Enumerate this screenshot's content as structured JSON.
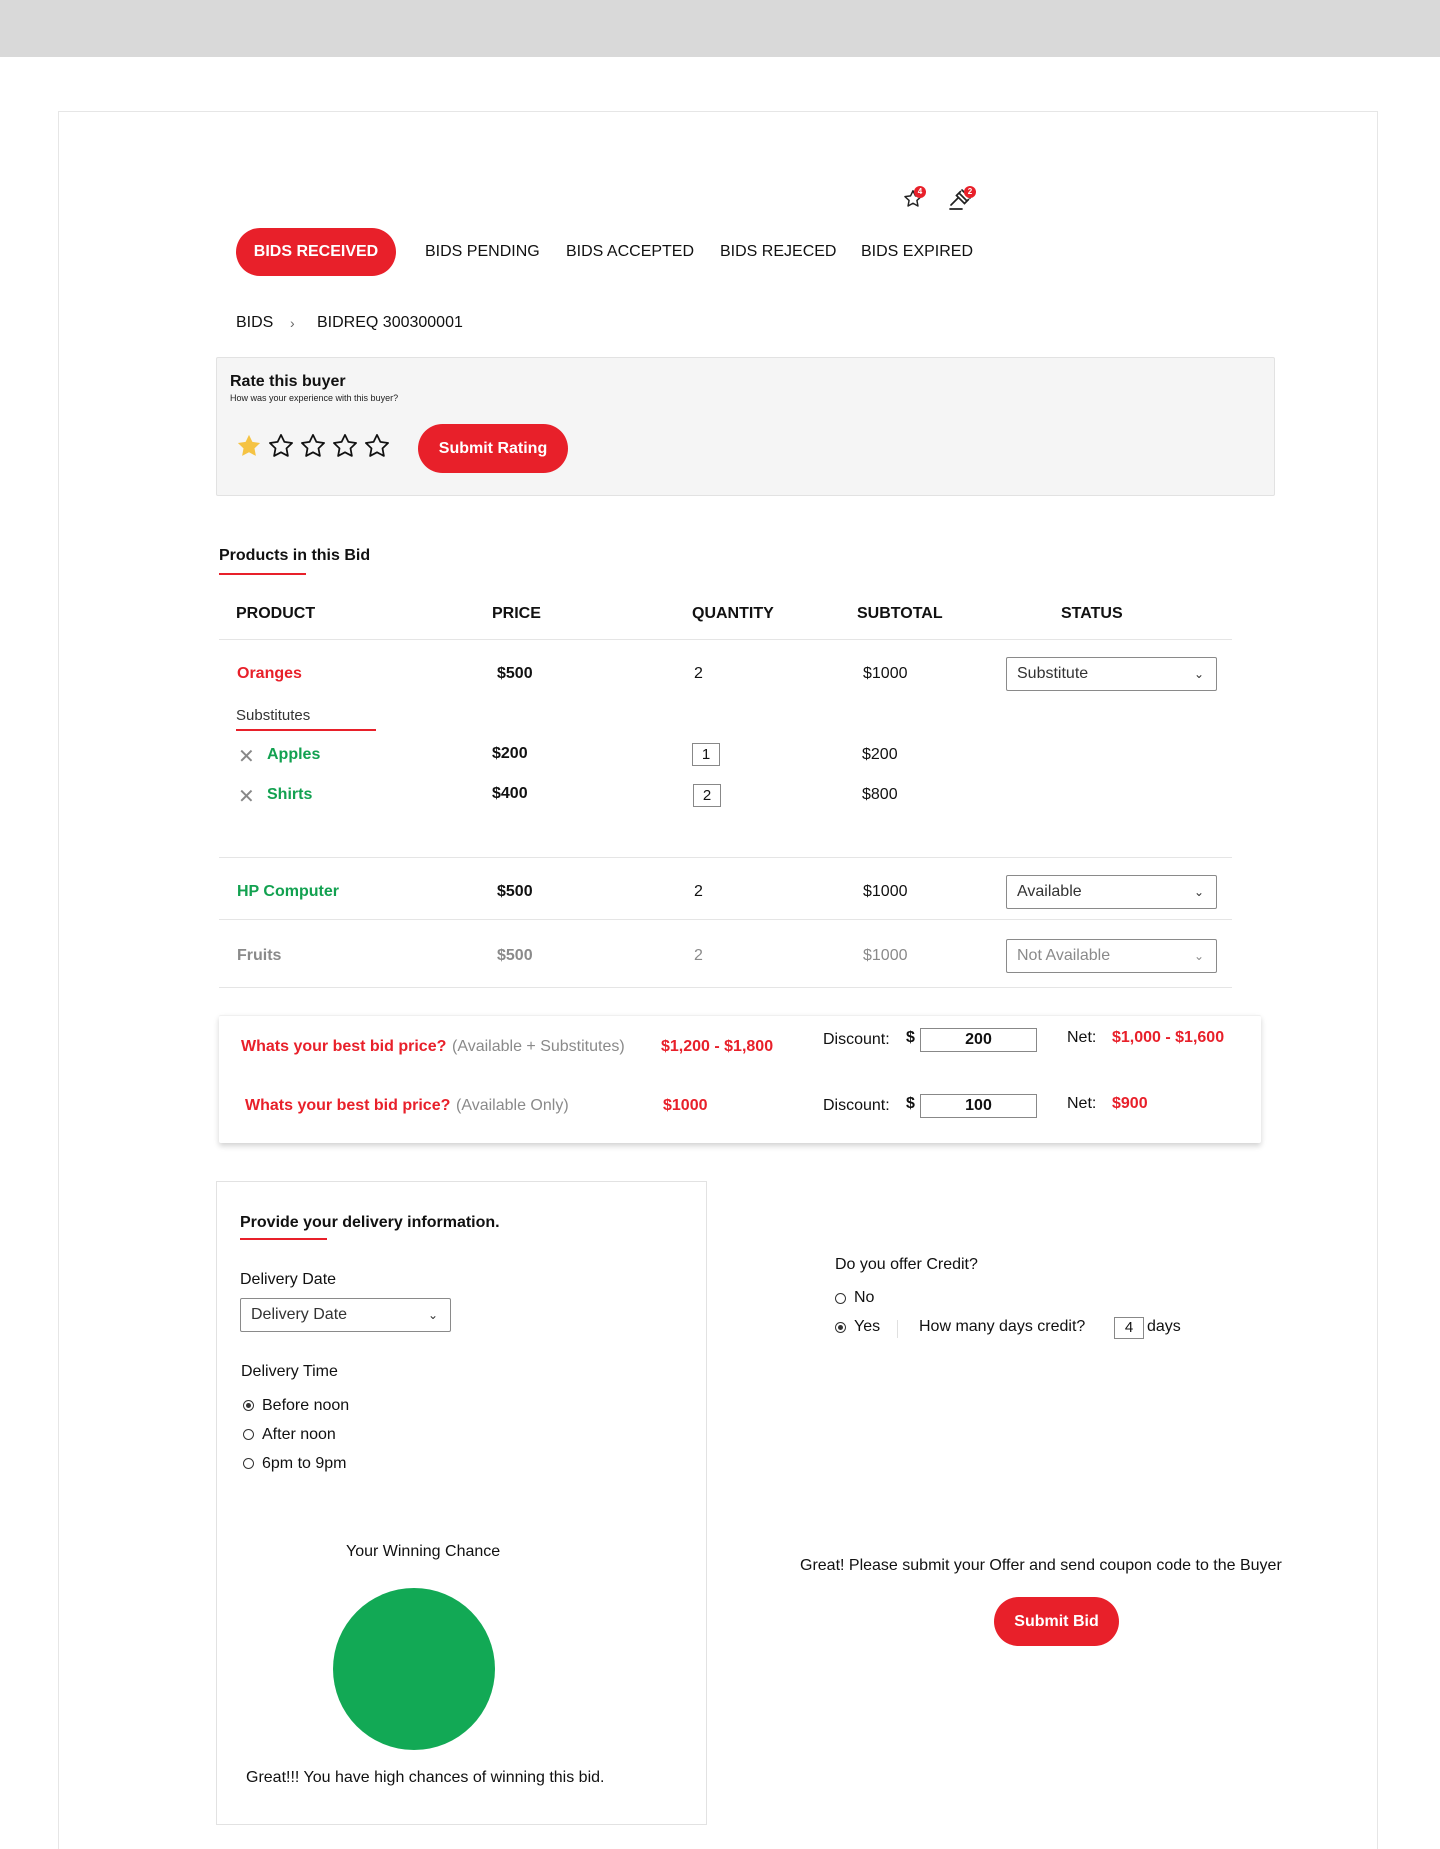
{
  "header": {
    "favorites_badge": "4",
    "bids_badge": "2"
  },
  "tabs": [
    {
      "label": "BIDS RECEIVED",
      "active": true
    },
    {
      "label": "BIDS PENDING",
      "active": false
    },
    {
      "label": "BIDS ACCEPTED",
      "active": false
    },
    {
      "label": "BIDS REJECED",
      "active": false
    },
    {
      "label": "BIDS EXPIRED",
      "active": false
    }
  ],
  "breadcrumb": {
    "root": "BIDS",
    "separator": "›",
    "current": "BIDREQ 300300001"
  },
  "rating": {
    "title": "Rate this buyer",
    "subtitle": "How was your experience with this buyer?",
    "stars_filled": 1,
    "stars_total": 5,
    "submit_label": "Submit Rating"
  },
  "products": {
    "section_title": "Products in this Bid",
    "columns": [
      "PRODUCT",
      "PRICE",
      "QUANTITY",
      "SUBTOTAL",
      "STATUS"
    ],
    "rows": [
      {
        "name": "Oranges",
        "price": "$500",
        "quantity": "2",
        "subtotal": "$1000",
        "status": "Substitute"
      },
      {
        "name": "HP Computer",
        "price": "$500",
        "quantity": "2",
        "subtotal": "$1000",
        "status": "Available"
      },
      {
        "name": "Fruits",
        "price": "$500",
        "quantity": "2",
        "subtotal": "$1000",
        "status": "Not Available"
      }
    ],
    "substitutes_label": "Substitutes",
    "substitutes": [
      {
        "name": "Apples",
        "price": "$200",
        "quantity": "1",
        "subtotal": "$200"
      },
      {
        "name": "Shirts",
        "price": "$400",
        "quantity": "2",
        "subtotal": "$800"
      }
    ]
  },
  "bid_price": {
    "rows": [
      {
        "question": "Whats your best bid price?",
        "qualifier": "(Available + Substitutes)",
        "range": "$1,200 - $1,800",
        "discount_label": "Discount:",
        "currency": "$",
        "discount": "200",
        "net_label": "Net:",
        "net": "$1,000 - $1,600"
      },
      {
        "question": "Whats your best bid price?",
        "qualifier": "(Available Only)",
        "range": "$1000",
        "discount_label": "Discount:",
        "currency": "$",
        "discount": "100",
        "net_label": "Net:",
        "net": "$900"
      }
    ]
  },
  "delivery": {
    "title": "Provide your delivery information.",
    "date_label": "Delivery Date",
    "date_placeholder": "Delivery Date",
    "time_label": "Delivery Time",
    "time_options": [
      "Before noon",
      "After noon",
      "6pm to 9pm"
    ],
    "time_selected": "Before noon",
    "winning_title": "Your Winning Chance",
    "winning_message": "Great!!! You have high chances of winning this bid.",
    "winning_color": "#12a955"
  },
  "credit": {
    "question": "Do you offer Credit?",
    "options": [
      "No",
      "Yes"
    ],
    "selected": "Yes",
    "days_question": "How many days credit?",
    "days_value": "4",
    "days_unit": "days"
  },
  "submit": {
    "message": "Great! Please submit your Offer and send coupon code to the Buyer",
    "button_label": "Submit Bid"
  },
  "colors": {
    "accent": "#e8202a",
    "available": "#12a150",
    "unavailable": "#8a8a8a",
    "star": "#f5c343"
  }
}
